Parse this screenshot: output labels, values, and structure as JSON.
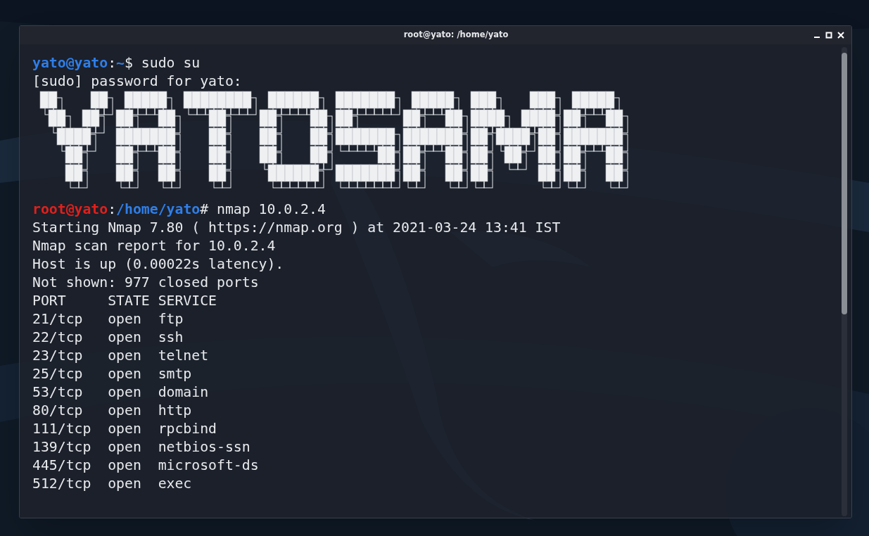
{
  "window": {
    "title": "root@yato: /home/yato"
  },
  "terminal": {
    "lines": [
      {
        "kind": "text",
        "segments": [
          {
            "kind": "user",
            "text": "yato@yato"
          },
          {
            "kind": "plain",
            "text": ":"
          },
          {
            "kind": "path",
            "text": "~"
          },
          {
            "kind": "plain",
            "text": "$ sudo su"
          }
        ]
      },
      {
        "kind": "text",
        "segments": [
          {
            "kind": "plain",
            "text": "[sudo] password for yato:"
          }
        ]
      },
      {
        "kind": "banner"
      },
      {
        "kind": "text",
        "segments": [
          {
            "kind": "root",
            "text": "root@yato"
          },
          {
            "kind": "plain",
            "text": ":"
          },
          {
            "kind": "path",
            "text": "/home/yato"
          },
          {
            "kind": "plain",
            "text": "# nmap 10.0.2.4"
          }
        ]
      },
      {
        "kind": "text",
        "segments": [
          {
            "kind": "plain",
            "text": "Starting Nmap 7.80 ( https://nmap.org ) at 2021-03-24 13:41 IST"
          }
        ]
      },
      {
        "kind": "text",
        "segments": [
          {
            "kind": "plain",
            "text": "Nmap scan report for 10.0.2.4"
          }
        ]
      },
      {
        "kind": "text",
        "segments": [
          {
            "kind": "plain",
            "text": "Host is up (0.00022s latency)."
          }
        ]
      },
      {
        "kind": "text",
        "segments": [
          {
            "kind": "plain",
            "text": "Not shown: 977 closed ports"
          }
        ]
      }
    ],
    "table": {
      "columns": [
        "PORT",
        "STATE",
        "SERVICE"
      ],
      "rows": [
        [
          "21/tcp",
          "open",
          "ftp"
        ],
        [
          "22/tcp",
          "open",
          "ssh"
        ],
        [
          "23/tcp",
          "open",
          "telnet"
        ],
        [
          "25/tcp",
          "open",
          "smtp"
        ],
        [
          "53/tcp",
          "open",
          "domain"
        ],
        [
          "80/tcp",
          "open",
          "http"
        ],
        [
          "111/tcp",
          "open",
          "rpcbind"
        ],
        [
          "139/tcp",
          "open",
          "netbios-ssn"
        ],
        [
          "445/tcp",
          "open",
          "microsoft-ds"
        ],
        [
          "512/tcp",
          "open",
          "exec"
        ]
      ]
    }
  }
}
